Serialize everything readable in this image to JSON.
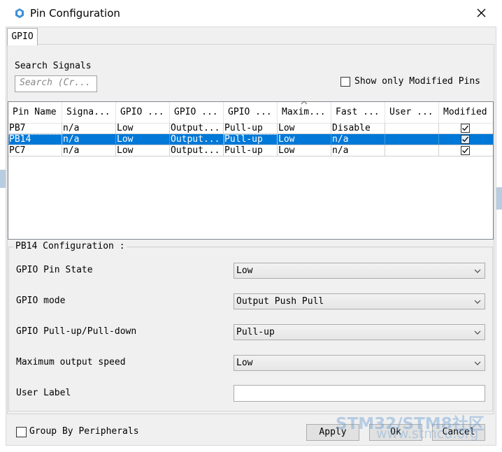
{
  "window": {
    "title": "Pin Configuration"
  },
  "tab": {
    "label": "GPIO"
  },
  "search": {
    "label": "Search Signals",
    "placeholder": "Search (Cr..."
  },
  "show_modified": {
    "label": "Show only Modified Pins",
    "checked": false
  },
  "table": {
    "columns": [
      "Pin Name",
      "Signa...",
      "GPIO ...",
      "GPIO ...",
      "GPIO ...",
      "Maxim...",
      "Fast ...",
      "User ...",
      "Modified"
    ],
    "rows": [
      {
        "cells": [
          "PB7",
          "n/a",
          "Low",
          "Output...",
          "Pull-up",
          "Low",
          "Disable",
          ""
        ],
        "modified": true,
        "selected": false
      },
      {
        "cells": [
          "PB14",
          "n/a",
          "Low",
          "Output...",
          "Pull-up",
          "Low",
          "n/a",
          ""
        ],
        "modified": true,
        "selected": true
      },
      {
        "cells": [
          "PC7",
          "n/a",
          "Low",
          "Output...",
          "Pull-up",
          "Low",
          "n/a",
          ""
        ],
        "modified": true,
        "selected": false
      }
    ]
  },
  "config": {
    "title": "PB14 Configuration :",
    "fields": [
      {
        "label": "GPIO Pin State",
        "value": "Low"
      },
      {
        "label": "GPIO mode",
        "value": "Output Push Pull"
      },
      {
        "label": "GPIO Pull-up/Pull-down",
        "value": "Pull-up"
      },
      {
        "label": "Maximum output speed",
        "value": "Low"
      }
    ],
    "user_label": {
      "label": "User Label",
      "value": ""
    }
  },
  "footer": {
    "group_by": {
      "label": "Group By Peripherals",
      "checked": false
    },
    "apply": "Apply",
    "ok": "Ok",
    "cancel": "Cancel"
  },
  "watermark": {
    "line1": "STM32/STM8社区",
    "line2": "www.stmcu.org"
  },
  "colors": {
    "selection": "#0078d7",
    "panel_bg": "#f0f0f0"
  }
}
